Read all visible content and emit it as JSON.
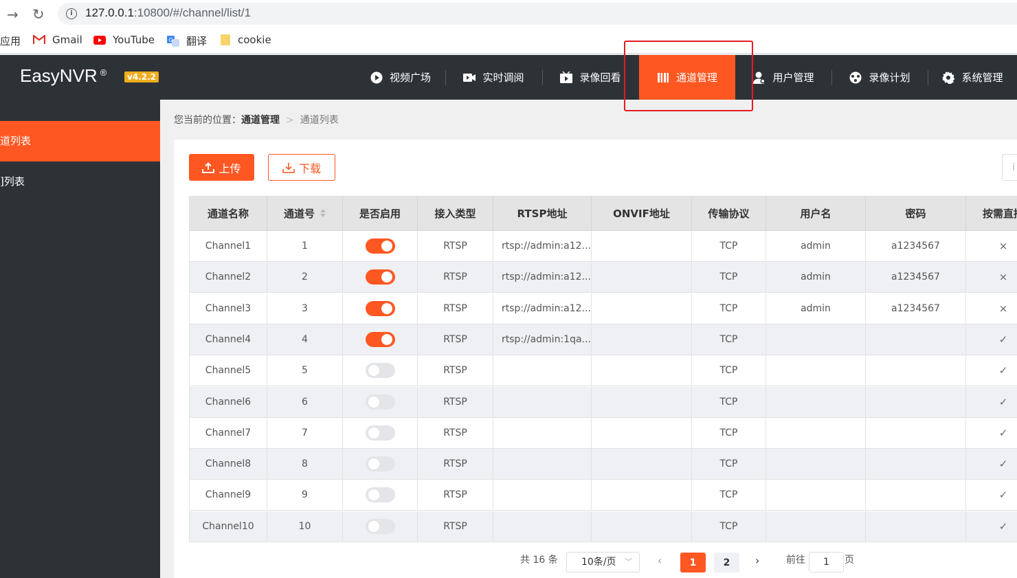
{
  "browser": {
    "url_host": "127.0.0.1",
    "url_rest": ":10800/#/channel/list/1",
    "bookmarks": [
      {
        "label": "应用",
        "icon": "apps-icon"
      },
      {
        "label": "Gmail",
        "icon": "gmail-icon"
      },
      {
        "label": "YouTube",
        "icon": "youtube-icon"
      },
      {
        "label": "翻译",
        "icon": "translate-icon"
      },
      {
        "label": "cookie",
        "icon": "folder-icon"
      }
    ]
  },
  "header": {
    "brand": "EasyNVR",
    "brand_mark": "®",
    "version": "v4.2.2",
    "nav": [
      {
        "label": "视频广场",
        "icon": "play-circle-icon"
      },
      {
        "label": "实时调阅",
        "icon": "video-camera-icon"
      },
      {
        "label": "录像回看",
        "icon": "playback-icon"
      },
      {
        "label": "通道管理",
        "icon": "book-icon",
        "active": true
      },
      {
        "label": "用户管理",
        "icon": "user-icon"
      },
      {
        "label": "录像计划",
        "icon": "schedule-icon"
      },
      {
        "label": "系统管理",
        "icon": "gear-icon"
      }
    ]
  },
  "sidebar": {
    "items": [
      {
        "label": "道列表",
        "active": true
      },
      {
        "label": "]列表",
        "active": false
      }
    ]
  },
  "breadcrumb": {
    "prefix": "您当前的位置：",
    "parent": "通道管理",
    "current": "通道列表"
  },
  "toolbar": {
    "upload": "上传",
    "download": "下载",
    "right_btn": "i"
  },
  "table": {
    "columns": [
      "通道名称",
      "通道号",
      "是否启用",
      "接入类型",
      "RTSP地址",
      "ONVIF地址",
      "传输协议",
      "用户名",
      "密码",
      "按需直播"
    ],
    "rows": [
      {
        "name": "Channel1",
        "num": "1",
        "enabled": true,
        "type": "RTSP",
        "rtsp": "rtsp://admin:a12...",
        "onvif": "",
        "proto": "TCP",
        "user": "admin",
        "pwd": "a1234567",
        "ondemand": "×"
      },
      {
        "name": "Channel2",
        "num": "2",
        "enabled": true,
        "type": "RTSP",
        "rtsp": "rtsp://admin:a12...",
        "onvif": "",
        "proto": "TCP",
        "user": "admin",
        "pwd": "a1234567",
        "ondemand": "×"
      },
      {
        "name": "Channel3",
        "num": "3",
        "enabled": true,
        "type": "RTSP",
        "rtsp": "rtsp://admin:a12...",
        "onvif": "",
        "proto": "TCP",
        "user": "admin",
        "pwd": "a1234567",
        "ondemand": "×"
      },
      {
        "name": "Channel4",
        "num": "4",
        "enabled": true,
        "type": "RTSP",
        "rtsp": "rtsp://admin:1qa...",
        "onvif": "",
        "proto": "TCP",
        "user": "",
        "pwd": "",
        "ondemand": "✓"
      },
      {
        "name": "Channel5",
        "num": "5",
        "enabled": false,
        "type": "RTSP",
        "rtsp": "",
        "onvif": "",
        "proto": "TCP",
        "user": "",
        "pwd": "",
        "ondemand": "✓"
      },
      {
        "name": "Channel6",
        "num": "6",
        "enabled": false,
        "type": "RTSP",
        "rtsp": "",
        "onvif": "",
        "proto": "TCP",
        "user": "",
        "pwd": "",
        "ondemand": "✓"
      },
      {
        "name": "Channel7",
        "num": "7",
        "enabled": false,
        "type": "RTSP",
        "rtsp": "",
        "onvif": "",
        "proto": "TCP",
        "user": "",
        "pwd": "",
        "ondemand": "✓"
      },
      {
        "name": "Channel8",
        "num": "8",
        "enabled": false,
        "type": "RTSP",
        "rtsp": "",
        "onvif": "",
        "proto": "TCP",
        "user": "",
        "pwd": "",
        "ondemand": "✓"
      },
      {
        "name": "Channel9",
        "num": "9",
        "enabled": false,
        "type": "RTSP",
        "rtsp": "",
        "onvif": "",
        "proto": "TCP",
        "user": "",
        "pwd": "",
        "ondemand": "✓"
      },
      {
        "name": "Channel10",
        "num": "10",
        "enabled": false,
        "type": "RTSP",
        "rtsp": "",
        "onvif": "",
        "proto": "TCP",
        "user": "",
        "pwd": "",
        "ondemand": "✓"
      }
    ]
  },
  "pagination": {
    "total": "共 16 条",
    "page_size": "10条/页",
    "pages": [
      "1",
      "2"
    ],
    "current": "1",
    "goto_label": "前往",
    "goto_value": "1",
    "page_suffix": "页"
  },
  "colors": {
    "accent": "#ff5722",
    "header_bg": "#2d3237",
    "highlight_box": "#e51c23"
  }
}
